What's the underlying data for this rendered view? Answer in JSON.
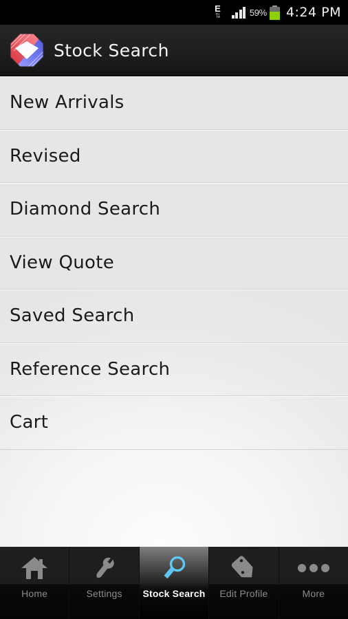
{
  "status_bar": {
    "network_type": "E",
    "network_arrows": "⇅",
    "battery_percent": "59%",
    "battery_level": 59,
    "time": "4:24 PM",
    "signal_bars": 4
  },
  "header": {
    "title": "Stock Search",
    "logo_name": "diamond-octagon-logo",
    "logo_colors": {
      "red": "#e8414a",
      "blue": "#5b63e8",
      "white": "#ffffff"
    }
  },
  "list": {
    "items": [
      {
        "label": "New Arrivals"
      },
      {
        "label": "Revised"
      },
      {
        "label": "Diamond Search"
      },
      {
        "label": "View Quote"
      },
      {
        "label": "Saved Search"
      },
      {
        "label": "Reference Search"
      },
      {
        "label": "Cart"
      }
    ]
  },
  "tab_bar": {
    "active_index": 2,
    "active_color": "#5ec8f2",
    "inactive_color": "#8c8c8c",
    "tabs": [
      {
        "label": "Home",
        "icon": "home-icon"
      },
      {
        "label": "Settings",
        "icon": "wrench-icon"
      },
      {
        "label": "Stock Search",
        "icon": "magnifier-icon"
      },
      {
        "label": "Edit Profile",
        "icon": "pencil-icon"
      },
      {
        "label": "More",
        "icon": "ellipsis-icon"
      }
    ]
  }
}
